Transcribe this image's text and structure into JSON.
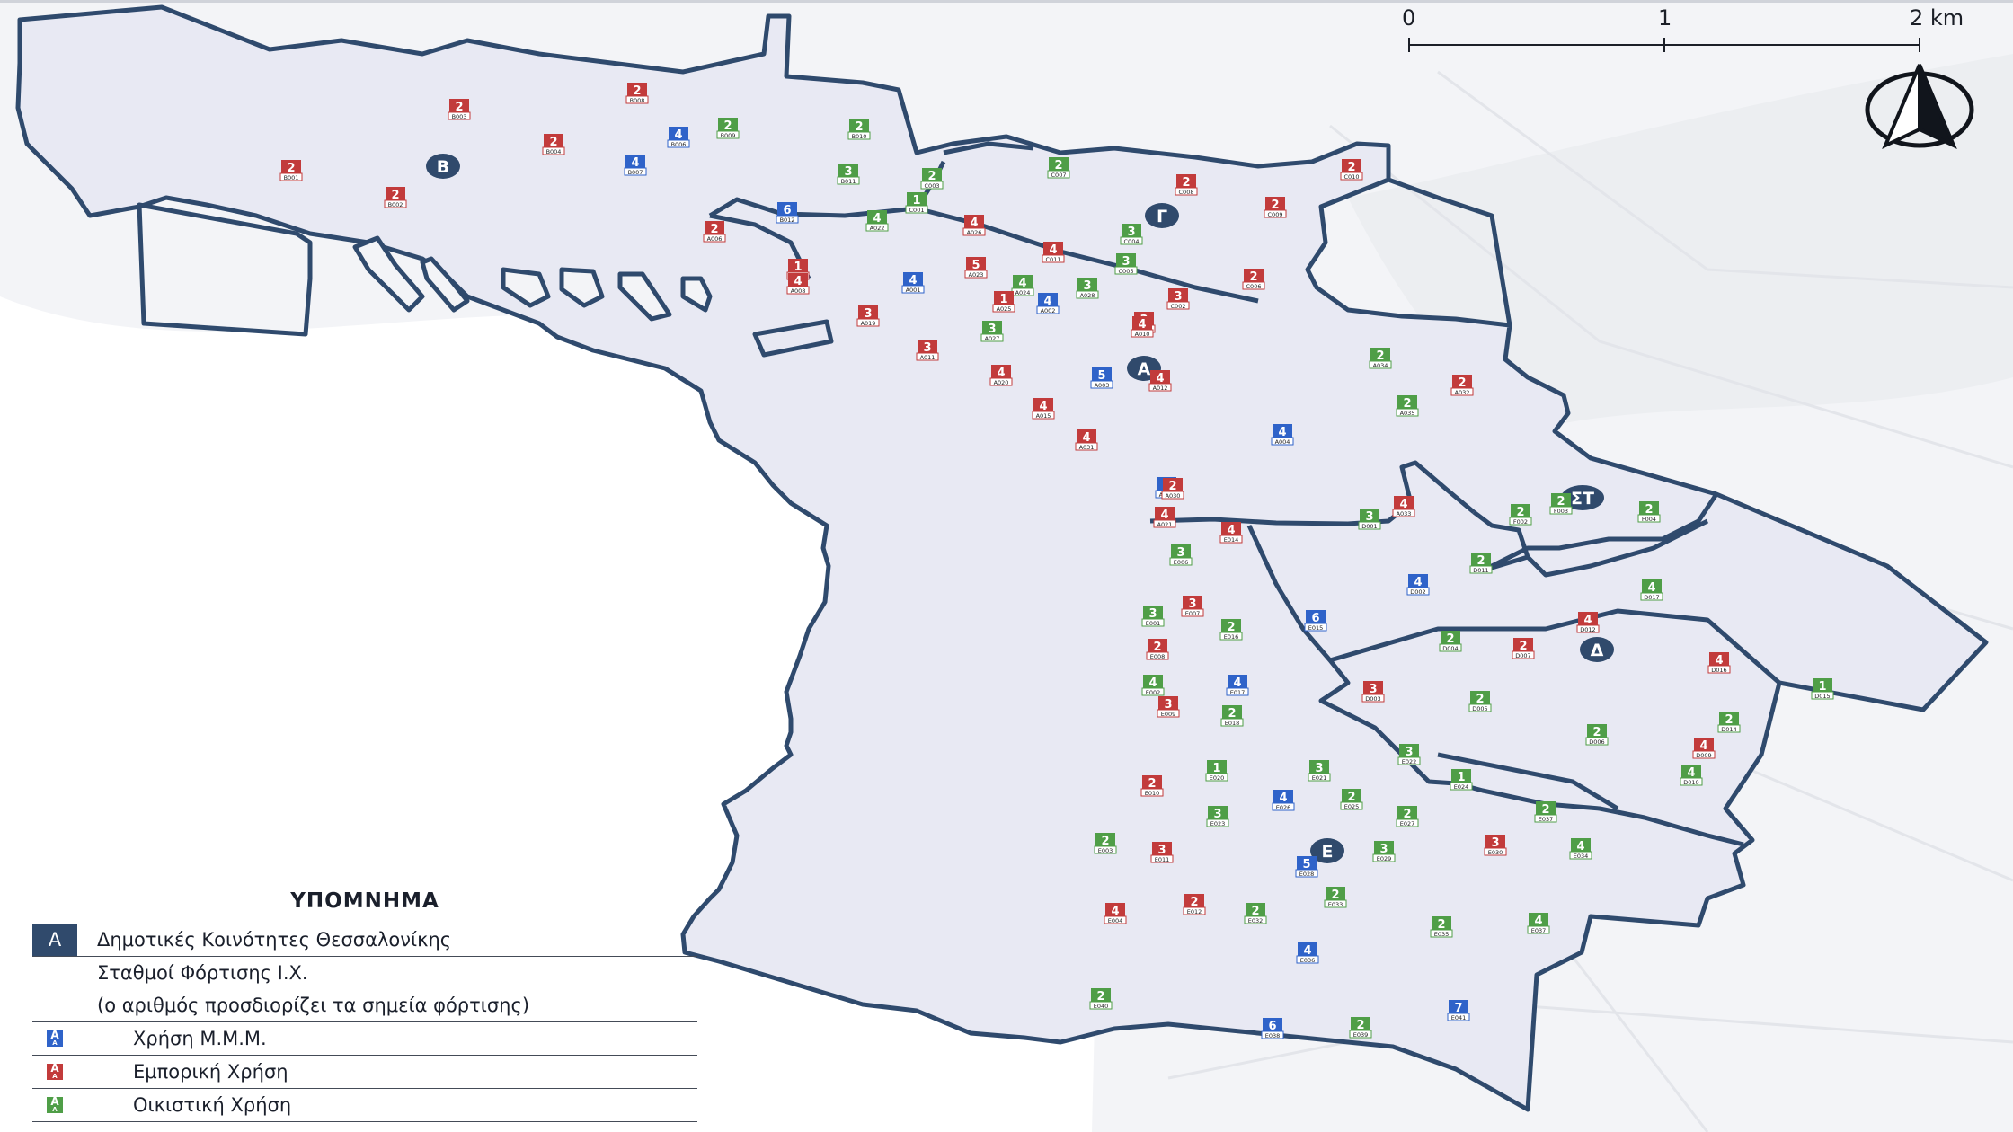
{
  "scale_bar": {
    "ticks": [
      "0",
      "1",
      "2 km"
    ]
  },
  "north_arrow": {
    "icon": "north-arrow-icon"
  },
  "colors": {
    "boundary": "#2f4a6d",
    "district_fill": "#e7e9f3",
    "mmm": "#2f63c9",
    "commercial": "#c23b3b",
    "residential": "#4f9e47",
    "community_badge": "#304a6c"
  },
  "communities": [
    {
      "label": "Β"
    },
    {
      "label": "Γ"
    },
    {
      "label": "Α"
    },
    {
      "label": "ΣΤ"
    },
    {
      "label": "Δ"
    },
    {
      "label": "Ε"
    }
  ],
  "stations": [
    {
      "n": "2",
      "code": "B003",
      "use": "commercial"
    },
    {
      "n": "2",
      "code": "B008",
      "use": "commercial"
    },
    {
      "n": "2",
      "code": "B001",
      "use": "commercial"
    },
    {
      "n": "2",
      "code": "B002",
      "use": "commercial"
    },
    {
      "n": "2",
      "code": "B004",
      "use": "commercial"
    },
    {
      "n": "4",
      "code": "B006",
      "use": "mmm"
    },
    {
      "n": "2",
      "code": "B009",
      "use": "residential"
    },
    {
      "n": "4",
      "code": "B007",
      "use": "mmm"
    },
    {
      "n": "2",
      "code": "B010",
      "use": "residential"
    },
    {
      "n": "3",
      "code": "B011",
      "use": "residential"
    },
    {
      "n": "6",
      "code": "B012",
      "use": "mmm"
    },
    {
      "n": "2",
      "code": "C003",
      "use": "residential"
    },
    {
      "n": "1",
      "code": "C001",
      "use": "residential"
    },
    {
      "n": "2",
      "code": "C007",
      "use": "residential"
    },
    {
      "n": "2",
      "code": "C008",
      "use": "commercial"
    },
    {
      "n": "2",
      "code": "C010",
      "use": "commercial"
    },
    {
      "n": "2",
      "code": "C009",
      "use": "commercial"
    },
    {
      "n": "3",
      "code": "C004",
      "use": "residential"
    },
    {
      "n": "3",
      "code": "C005",
      "use": "residential"
    },
    {
      "n": "2",
      "code": "C006",
      "use": "commercial"
    },
    {
      "n": "3",
      "code": "C002",
      "use": "commercial"
    },
    {
      "n": "2",
      "code": "A006",
      "use": "commercial"
    },
    {
      "n": "4",
      "code": "A022",
      "use": "residential"
    },
    {
      "n": "4",
      "code": "A026",
      "use": "commercial"
    },
    {
      "n": "4",
      "code": "C011",
      "use": "commercial"
    },
    {
      "n": "1",
      "code": "A017",
      "use": "commercial"
    },
    {
      "n": "4",
      "code": "A008",
      "use": "commercial"
    },
    {
      "n": "4",
      "code": "A001",
      "use": "mmm"
    },
    {
      "n": "5",
      "code": "A023",
      "use": "commercial"
    },
    {
      "n": "4",
      "code": "A024",
      "use": "residential"
    },
    {
      "n": "1",
      "code": "A025",
      "use": "commercial"
    },
    {
      "n": "4",
      "code": "A002",
      "use": "mmm"
    },
    {
      "n": "3",
      "code": "A028",
      "use": "residential"
    },
    {
      "n": "3",
      "code": "A009",
      "use": "commercial"
    },
    {
      "n": "3",
      "code": "A019",
      "use": "commercial"
    },
    {
      "n": "3",
      "code": "A027",
      "use": "residential"
    },
    {
      "n": "4",
      "code": "A010",
      "use": "commercial"
    },
    {
      "n": "3",
      "code": "A011",
      "use": "commercial"
    },
    {
      "n": "4",
      "code": "A020",
      "use": "commercial"
    },
    {
      "n": "5",
      "code": "A003",
      "use": "mmm"
    },
    {
      "n": "4",
      "code": "A012",
      "use": "commercial"
    },
    {
      "n": "4",
      "code": "A015",
      "use": "commercial"
    },
    {
      "n": "4",
      "code": "A031",
      "use": "commercial"
    },
    {
      "n": "2",
      "code": "A034",
      "use": "residential"
    },
    {
      "n": "2",
      "code": "A032",
      "use": "commercial"
    },
    {
      "n": "2",
      "code": "A035",
      "use": "residential"
    },
    {
      "n": "4",
      "code": "A004",
      "use": "mmm"
    },
    {
      "n": "4",
      "code": "A033",
      "use": "commercial"
    },
    {
      "n": "2",
      "code": "A005",
      "use": "mmm"
    },
    {
      "n": "2",
      "code": "A030",
      "use": "commercial"
    },
    {
      "n": "4",
      "code": "A021",
      "use": "commercial"
    },
    {
      "n": "2",
      "code": "F002",
      "use": "residential"
    },
    {
      "n": "2",
      "code": "F003",
      "use": "residential"
    },
    {
      "n": "2",
      "code": "F004",
      "use": "residential"
    },
    {
      "n": "4",
      "code": "E014",
      "use": "commercial"
    },
    {
      "n": "3",
      "code": "E006",
      "use": "residential"
    },
    {
      "n": "3",
      "code": "D001",
      "use": "residential"
    },
    {
      "n": "2",
      "code": "D011",
      "use": "residential"
    },
    {
      "n": "4",
      "code": "D002",
      "use": "mmm"
    },
    {
      "n": "4",
      "code": "D017",
      "use": "residential"
    },
    {
      "n": "3",
      "code": "E001",
      "use": "residential"
    },
    {
      "n": "3",
      "code": "E007",
      "use": "commercial"
    },
    {
      "n": "2",
      "code": "E016",
      "use": "residential"
    },
    {
      "n": "6",
      "code": "E015",
      "use": "mmm"
    },
    {
      "n": "2",
      "code": "D004",
      "use": "residential"
    },
    {
      "n": "2",
      "code": "D007",
      "use": "commercial"
    },
    {
      "n": "4",
      "code": "D012",
      "use": "commercial"
    },
    {
      "n": "2",
      "code": "E008",
      "use": "commercial"
    },
    {
      "n": "4",
      "code": "E002",
      "use": "residential"
    },
    {
      "n": "4",
      "code": "E017",
      "use": "mmm"
    },
    {
      "n": "3",
      "code": "D003",
      "use": "commercial"
    },
    {
      "n": "2",
      "code": "D008",
      "use": "residential"
    },
    {
      "n": "4",
      "code": "D016",
      "use": "commercial"
    },
    {
      "n": "1",
      "code": "D015",
      "use": "residential"
    },
    {
      "n": "3",
      "code": "E009",
      "use": "commercial"
    },
    {
      "n": "2",
      "code": "E018",
      "use": "residential"
    },
    {
      "n": "2",
      "code": "D005",
      "use": "residential"
    },
    {
      "n": "2",
      "code": "D006",
      "use": "residential"
    },
    {
      "n": "2",
      "code": "D014",
      "use": "residential"
    },
    {
      "n": "4",
      "code": "D009",
      "use": "commercial"
    },
    {
      "n": "3",
      "code": "E022",
      "use": "residential"
    },
    {
      "n": "1",
      "code": "E020",
      "use": "residential"
    },
    {
      "n": "3",
      "code": "E021",
      "use": "residential"
    },
    {
      "n": "1",
      "code": "E024",
      "use": "residential"
    },
    {
      "n": "4",
      "code": "D010",
      "use": "residential"
    },
    {
      "n": "2",
      "code": "E010",
      "use": "commercial"
    },
    {
      "n": "4",
      "code": "E026",
      "use": "mmm"
    },
    {
      "n": "2",
      "code": "E025",
      "use": "residential"
    },
    {
      "n": "3",
      "code": "E023",
      "use": "residential"
    },
    {
      "n": "2",
      "code": "E027",
      "use": "residential"
    },
    {
      "n": "2",
      "code": "E037",
      "use": "residential"
    },
    {
      "n": "2",
      "code": "E003",
      "use": "residential"
    },
    {
      "n": "3",
      "code": "E011",
      "use": "commercial"
    },
    {
      "n": "5",
      "code": "E028",
      "use": "mmm"
    },
    {
      "n": "3",
      "code": "E029",
      "use": "residential"
    },
    {
      "n": "3",
      "code": "E030",
      "use": "commercial"
    },
    {
      "n": "4",
      "code": "E034",
      "use": "residential"
    },
    {
      "n": "2",
      "code": "E033",
      "use": "residential"
    },
    {
      "n": "4",
      "code": "E004",
      "use": "commercial"
    },
    {
      "n": "2",
      "code": "E012",
      "use": "commercial"
    },
    {
      "n": "2",
      "code": "E032",
      "use": "residential"
    },
    {
      "n": "2",
      "code": "E035",
      "use": "residential"
    },
    {
      "n": "4",
      "code": "E037",
      "use": "residential"
    },
    {
      "n": "4",
      "code": "E036",
      "use": "mmm"
    },
    {
      "n": "2",
      "code": "E040",
      "use": "residential"
    },
    {
      "n": "7",
      "code": "E041",
      "use": "mmm"
    },
    {
      "n": "6",
      "code": "E038",
      "use": "mmm"
    },
    {
      "n": "2",
      "code": "E039",
      "use": "residential"
    }
  ],
  "legend": {
    "title": "ΥΠΟΜΝΗΜΑ",
    "community_key": "Α",
    "community_text": "Δημοτικές Κοινότητες Θεσσαλονίκης",
    "stations_text": "Σταθμοί Φόρτισης Ι.Χ.",
    "stations_note": "(ο αριθμός προσδιορίζει τα σημεία φόρτισης)",
    "mmm_text": "Χρήση Μ.Μ.Μ.",
    "commercial_text": "Εμπορική Χρήση",
    "residential_text": "Οικιστική Χρήση",
    "sample_key": "Α"
  }
}
